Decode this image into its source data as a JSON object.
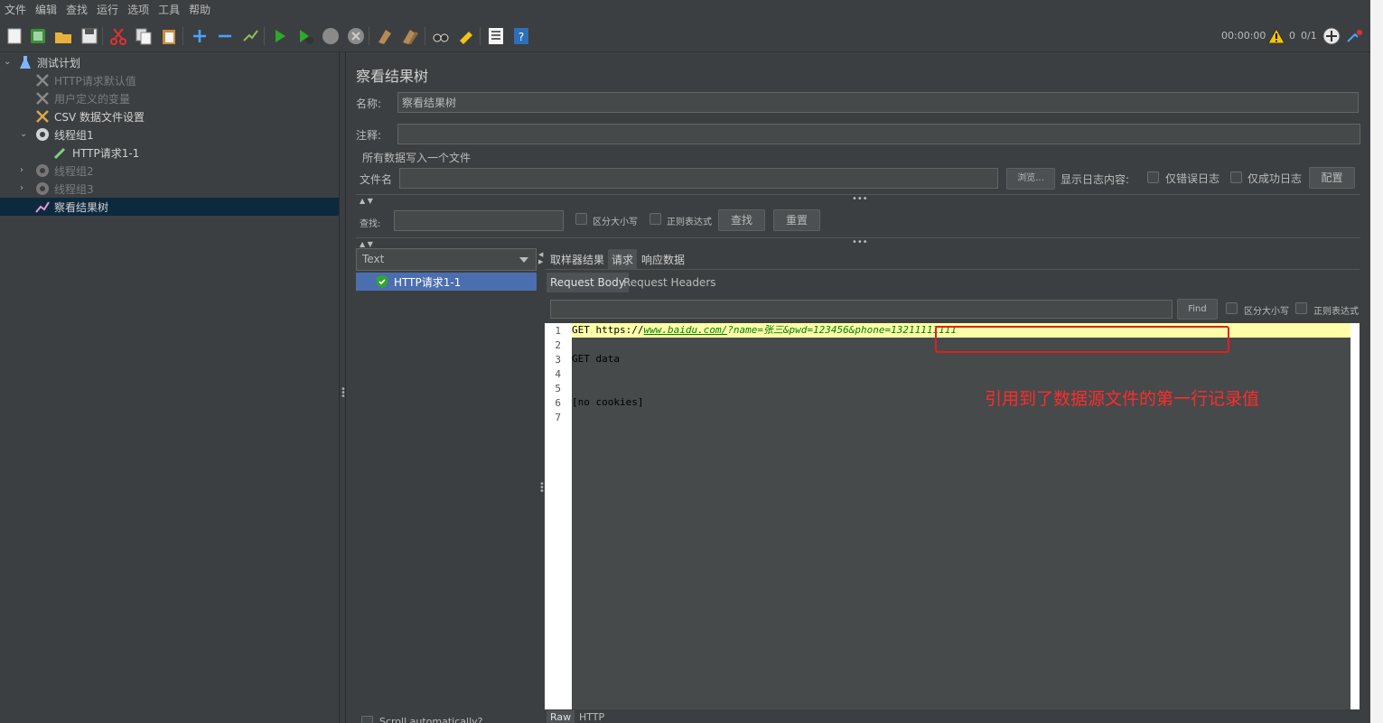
{
  "menu": [
    "文件",
    "编辑",
    "查找",
    "运行",
    "选项",
    "工具",
    "帮助"
  ],
  "toolbar_icons": [
    "new-icon",
    "templates-icon",
    "open-icon",
    "save-icon",
    "cut-icon",
    "copy-icon",
    "paste-icon",
    "expand-icon",
    "collapse-icon",
    "toggle-icon",
    "start-icon",
    "start-no-pause-icon",
    "stop-icon",
    "shutdown-icon",
    "clear-icon",
    "clear-all-icon",
    "search-icon",
    "reset-search-icon",
    "function-helper-icon",
    "help-icon"
  ],
  "status": {
    "time": "00:00:00",
    "errors": "0",
    "threads": "0/1"
  },
  "tree": {
    "items": [
      {
        "label": "测试计划",
        "level": 0,
        "enabled": true
      },
      {
        "label": "HTTP请求默认值",
        "level": 1,
        "enabled": false
      },
      {
        "label": "用户定义的变量",
        "level": 1,
        "enabled": false
      },
      {
        "label": "CSV 数据文件设置",
        "level": 1,
        "enabled": true
      },
      {
        "label": "线程组1",
        "level": 1,
        "enabled": true
      },
      {
        "label": "HTTP请求1-1",
        "level": 2,
        "enabled": true
      },
      {
        "label": "线程组2",
        "level": 1,
        "enabled": false
      },
      {
        "label": "线程组3",
        "level": 1,
        "enabled": false
      },
      {
        "label": "察看结果树",
        "level": 1,
        "enabled": true,
        "selected": true
      }
    ]
  },
  "panel": {
    "title": "察看结果树",
    "name_label": "名称:",
    "name_value": "察看结果树",
    "comment_label": "注释:",
    "comment_value": "",
    "file_section": "所有数据写入一个文件",
    "filename_label": "文件名",
    "filename_value": "",
    "browse": "浏览...",
    "log_label": "显示日志内容:",
    "errors_only": "仅错误日志",
    "success_only": "仅成功日志",
    "configure": "配置",
    "search_label": "查找:",
    "search_value": "",
    "case_sensitive": "区分大小写",
    "regex": "正则表达式",
    "find_button": "查找",
    "reset_button": "重置"
  },
  "results": {
    "renderer": "Text",
    "items": [
      "HTTP请求1-1"
    ],
    "scroll_auto": "Scroll automatically?"
  },
  "detail": {
    "tabs": [
      "取样器结果",
      "请求",
      "响应数据"
    ],
    "active_tab": "请求",
    "subtabs": [
      "Request Body",
      "Request Headers"
    ],
    "find_value": "",
    "find_button": "Find",
    "case_sensitive": "区分大小写",
    "regex": "正则表达式",
    "lines": [
      {
        "num": "1",
        "method": "GET https://",
        "url": "www.baidu.com/",
        "params": "?name=张三&pwd=123456&phone=13211111111"
      },
      {
        "num": "2",
        "text": ""
      },
      {
        "num": "3",
        "text": "GET data"
      },
      {
        "num": "4",
        "text": ""
      },
      {
        "num": "5",
        "text": ""
      },
      {
        "num": "6",
        "text": "[no cookies]"
      },
      {
        "num": "7",
        "text": ""
      }
    ],
    "bottom_tabs": [
      "Raw",
      "HTTP"
    ]
  },
  "annotation": "引用到了数据源文件的第一行记录值",
  "colors": {
    "background": "#3c3f41",
    "selection": "#4b6eaf",
    "highlight_line": "#ffffa8",
    "annotation": "#ff2b2b"
  }
}
